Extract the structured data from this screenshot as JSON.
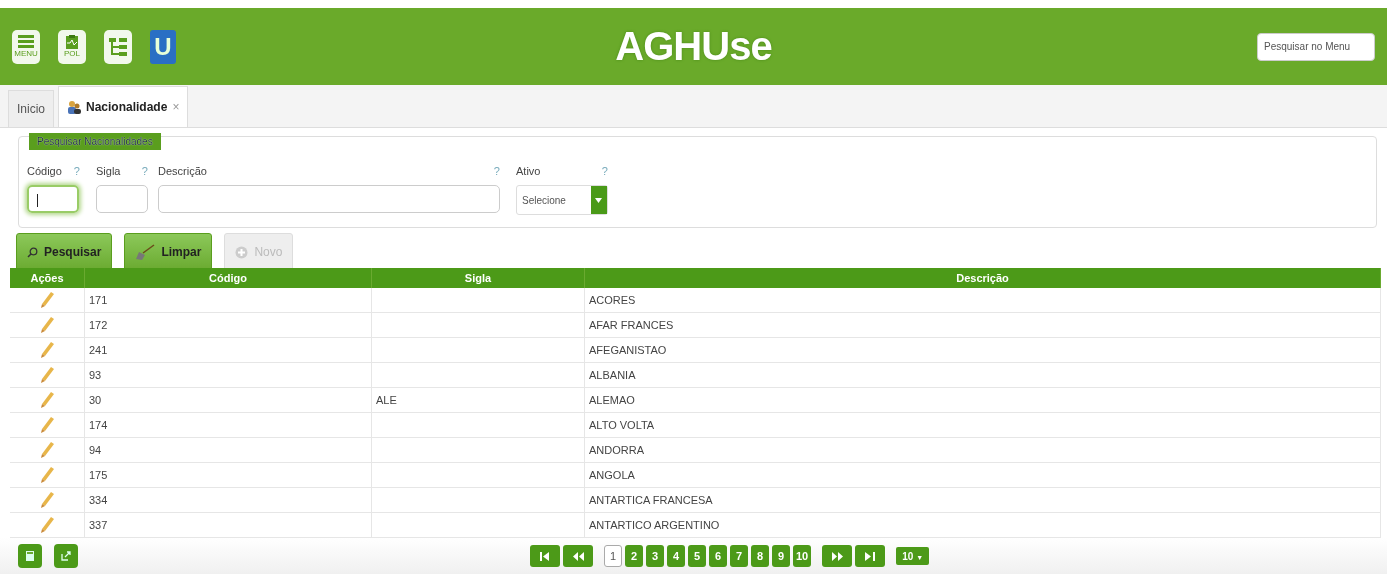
{
  "header": {
    "logo": "AGHUse",
    "icons": [
      {
        "kind": "menu",
        "label": "MENU"
      },
      {
        "kind": "pol",
        "label": "POL"
      },
      {
        "kind": "tree"
      },
      {
        "kind": "u",
        "label": "U"
      }
    ],
    "search": {
      "placeholder": "Pesquisar no Menu"
    }
  },
  "tabs": [
    {
      "label": "Inicio",
      "selected": false,
      "closable": false
    },
    {
      "label": "Nacionalidade",
      "selected": true,
      "closable": true,
      "close": "×"
    }
  ],
  "search_panel": {
    "title": "Pesquisar Nacionalidades",
    "fields": [
      {
        "kind": "text",
        "label": "Código",
        "help": "?",
        "focused": true
      },
      {
        "kind": "text",
        "label": "Sigla",
        "help": "?",
        "focused": false
      },
      {
        "kind": "wide",
        "label": "Descrição",
        "help": "?",
        "focused": false
      },
      {
        "kind": "select",
        "label": "Ativo",
        "help": "?",
        "value": "Selecione"
      }
    ]
  },
  "buttons": [
    {
      "kind": "search",
      "label": "Pesquisar",
      "disabled": false
    },
    {
      "kind": "clear",
      "label": "Limpar",
      "disabled": false
    },
    {
      "kind": "new",
      "label": "Novo",
      "disabled": true
    }
  ],
  "table": {
    "columns": [
      "Ações",
      "Código",
      "Sigla",
      "Descrição"
    ],
    "rows": [
      {
        "codigo": "171",
        "sigla": "",
        "descricao": "ACORES"
      },
      {
        "codigo": "172",
        "sigla": "",
        "descricao": "AFAR FRANCES"
      },
      {
        "codigo": "241",
        "sigla": "",
        "descricao": "AFEGANISTAO"
      },
      {
        "codigo": "93",
        "sigla": "",
        "descricao": "ALBANIA"
      },
      {
        "codigo": "30",
        "sigla": "ALE",
        "descricao": "ALEMAO"
      },
      {
        "codigo": "174",
        "sigla": "",
        "descricao": "ALTO VOLTA"
      },
      {
        "codigo": "94",
        "sigla": "",
        "descricao": "ANDORRA"
      },
      {
        "codigo": "175",
        "sigla": "",
        "descricao": "ANGOLA"
      },
      {
        "codigo": "334",
        "sigla": "",
        "descricao": "ANTARTICA FRANCESA"
      },
      {
        "codigo": "337",
        "sigla": "",
        "descricao": "ANTARTICO ARGENTINO"
      }
    ]
  },
  "pager": {
    "pages": [
      {
        "label": "1",
        "selected": true
      },
      {
        "label": "2",
        "selected": false
      },
      {
        "label": "3",
        "selected": false
      },
      {
        "label": "4",
        "selected": false
      },
      {
        "label": "5",
        "selected": false
      },
      {
        "label": "6",
        "selected": false
      },
      {
        "label": "7",
        "selected": false
      },
      {
        "label": "8",
        "selected": false
      },
      {
        "label": "9",
        "selected": false
      },
      {
        "label": "10",
        "selected": false
      }
    ],
    "page_size": "10",
    "page_size_arrow": "▼"
  }
}
